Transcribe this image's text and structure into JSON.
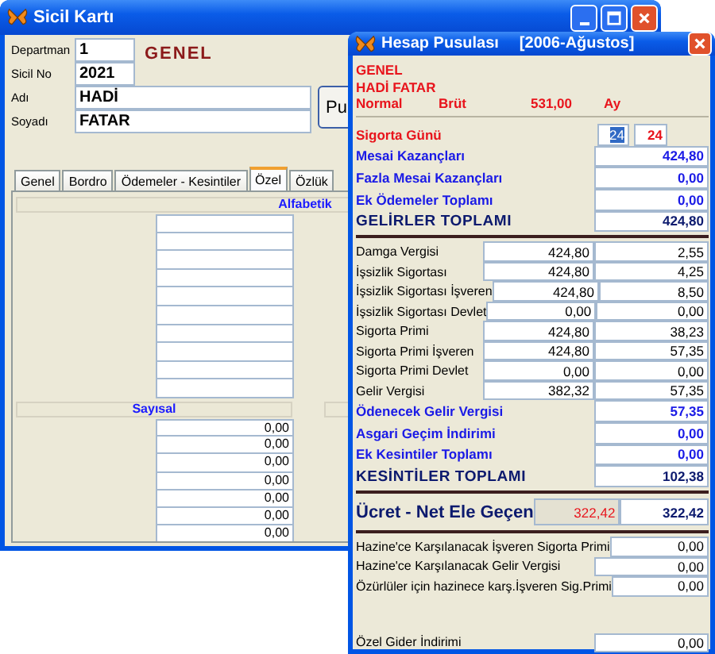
{
  "back_window": {
    "title": "Sicil Kartı",
    "fields": [
      {
        "label": "Departman",
        "value": "1",
        "wide": false
      },
      {
        "label": "Sicil No",
        "value": "2021",
        "wide": false
      },
      {
        "label": "Adı",
        "value": "HADİ",
        "wide": true
      },
      {
        "label": "Soyadı",
        "value": "FATAR",
        "wide": true
      }
    ],
    "section": "GENEL",
    "button": "Pu",
    "tabs": [
      {
        "label": "Genel",
        "selected": false
      },
      {
        "label": "Bordro",
        "selected": false
      },
      {
        "label": "Ödemeler - Kesintiler",
        "selected": false
      },
      {
        "label": "Özel",
        "selected": true
      },
      {
        "label": "Özlük",
        "selected": false
      }
    ],
    "alphabetic_header": "Alfabetik",
    "numeric_header": "Sayısal",
    "numeric_values": [
      "0,00",
      "0,00",
      "0,00",
      "0,00",
      "0,00",
      "0,00",
      "0,00"
    ]
  },
  "front_window": {
    "title": "Hesap Pusulası",
    "period": "[2006-Ağustos]",
    "header": {
      "department": "GENEL",
      "name": "HADİ FATAR",
      "type": "Normal",
      "basis": "Brüt",
      "amount": "531,00",
      "unit": "Ay"
    },
    "insurance_days": {
      "label": "Sigorta Günü",
      "value": "24",
      "highlighted": true,
      "value_2": "24"
    },
    "rows": [
      {
        "kind": "sum",
        "label": "Mesai Kazançları",
        "value": "424,80"
      },
      {
        "kind": "sum",
        "label": "Fazla Mesai Kazançları",
        "value": "0,00"
      },
      {
        "kind": "sum",
        "label": "Ek Ödemeler Toplamı",
        "value": "0,00"
      },
      {
        "kind": "total",
        "label": "GELİRLER TOPLAMI",
        "value": "424,80"
      },
      {
        "kind": "detail",
        "label": "Damga Vergisi",
        "base": "424,80",
        "value": "2,55"
      },
      {
        "kind": "detail",
        "label": "İşsizlik Sigortası",
        "base": "424,80",
        "value": "4,25"
      },
      {
        "kind": "detail",
        "label": "İşsizlik Sigortası İşveren",
        "base": "424,80",
        "value": "8,50"
      },
      {
        "kind": "detail",
        "label": "İşsizlik Sigortası Devlet",
        "base": "0,00",
        "value": "0,00"
      },
      {
        "kind": "detail",
        "label": "Sigorta Primi",
        "base": "424,80",
        "value": "38,23"
      },
      {
        "kind": "detail",
        "label": "Sigorta Primi İşveren",
        "base": "424,80",
        "value": "57,35"
      },
      {
        "kind": "detail",
        "label": "Sigorta Primi Devlet",
        "base": "0,00",
        "value": "0,00"
      },
      {
        "kind": "detail",
        "label": "Gelir Vergisi",
        "base": "382,32",
        "value": "57,35"
      },
      {
        "kind": "sum",
        "label": "Ödenecek Gelir Vergisi",
        "value": "57,35"
      },
      {
        "kind": "sum",
        "label": "Asgari Geçim İndirimi",
        "value": "0,00"
      },
      {
        "kind": "sum",
        "label": "Ek Kesintiler Toplamı",
        "value": "0,00"
      },
      {
        "kind": "total",
        "label": "KESİNTİLER TOPLAMI",
        "value": "102,38"
      },
      {
        "kind": "net",
        "label": "Ücret - Net Ele Geçen",
        "base": "322,42",
        "value": "322,42"
      },
      {
        "kind": "note",
        "label": "Hazine'ce Karşılanacak İşveren Sigorta Primi",
        "value": "0,00"
      },
      {
        "kind": "note",
        "label": "Hazine'ce Karşılanacak Gelir Vergisi",
        "value": "0,00"
      },
      {
        "kind": "note",
        "label": "Özürlüler için hazinece karş.İşveren Sig.Primi",
        "value": "0,00"
      },
      {
        "kind": "spaced_note",
        "label": "Özel Gider İndirimi",
        "value": "0,00"
      }
    ]
  }
}
